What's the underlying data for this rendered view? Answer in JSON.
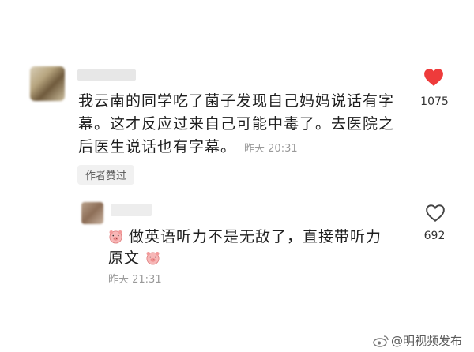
{
  "comment1": {
    "text": "我云南的同学吃了菌子发现自己妈妈说话有字幕。这才反应过来自己可能中毒了。去医院之后医生说话也有字幕。",
    "time": "昨天 20:31",
    "badge": "作者赞过",
    "likes": "1075",
    "liked": true,
    "like_color": "#ee3b3b"
  },
  "reply": {
    "text_a": "做英语听力不是无敌了，直接带听力",
    "text_b": "原文",
    "emoji": "pig-face-emoji",
    "time": "昨天 21:31",
    "likes": "692",
    "liked": false
  },
  "watermark": {
    "text": "@明视频发布",
    "icon": "weibo-icon"
  }
}
